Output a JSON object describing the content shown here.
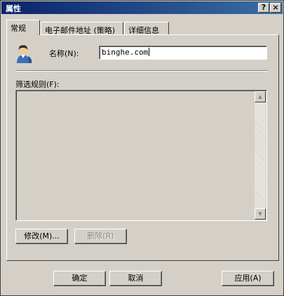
{
  "window": {
    "title": "属性",
    "help_glyph": "?",
    "close_glyph": "×"
  },
  "tabs": [
    {
      "label": "常规",
      "active": true
    },
    {
      "label": "电子邮件地址 (策略)",
      "active": false
    },
    {
      "label": "详细信息",
      "active": false
    }
  ],
  "general": {
    "name_label": "名称(N):",
    "name_value": "binghe.com",
    "filter_label": "筛选规则(F):"
  },
  "buttons": {
    "modify": "修改(M)...",
    "remove": "删除(R)",
    "ok": "确定",
    "cancel": "取消",
    "apply": "应用(A)"
  },
  "icons": {
    "scroll_up": "▲",
    "scroll_down": "▼"
  },
  "colors": {
    "title_start": "#0a246a",
    "title_end": "#3a6ea5",
    "face": "#d4d0c8"
  }
}
